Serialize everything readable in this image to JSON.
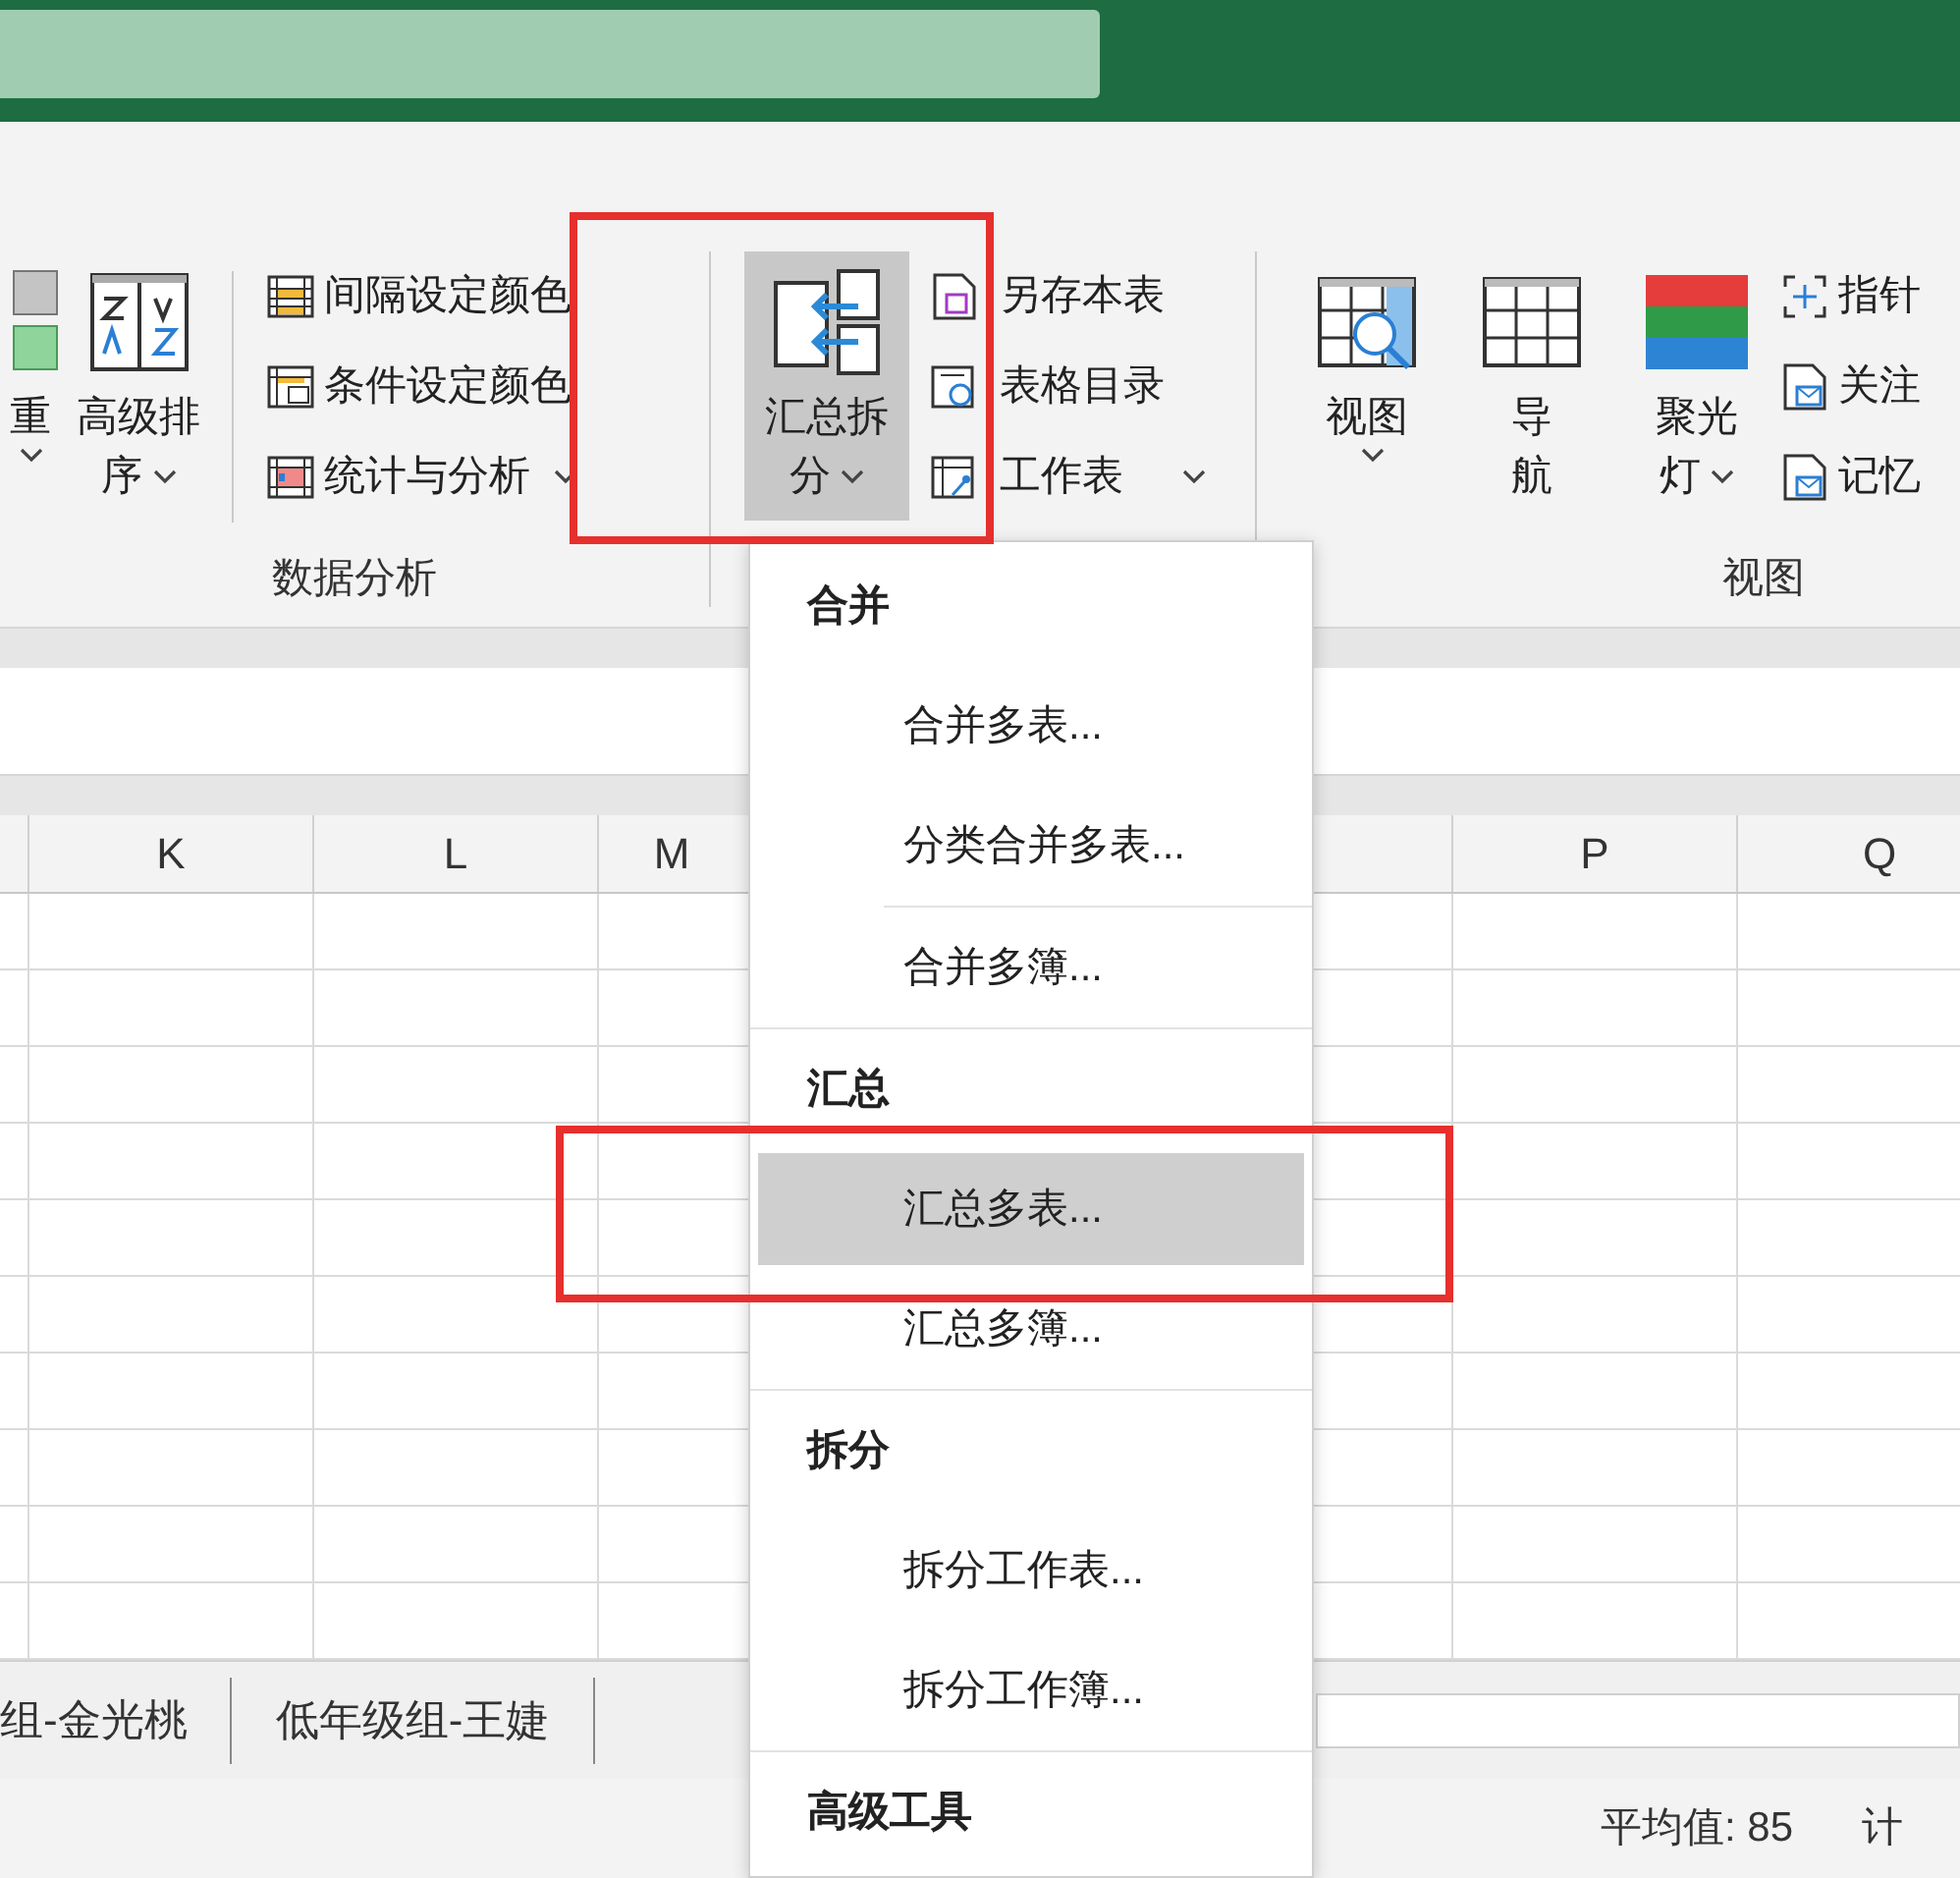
{
  "ribbon": {
    "groups": [
      {
        "label": "数据分析",
        "items": [
          {
            "kind": "large",
            "lines": [
              "重"
            ],
            "dropdown": true,
            "selected": false
          },
          {
            "kind": "large",
            "lines": [
              "高级排",
              "序"
            ],
            "dropdown": true,
            "selected": false
          },
          {
            "kind": "stack",
            "entries": [
              {
                "label": "间隔设定颜色",
                "dropdown": false
              },
              {
                "label": "条件设定颜色",
                "dropdown": false
              },
              {
                "label": "统计与分析",
                "dropdown": true
              }
            ]
          }
        ]
      },
      {
        "items": [
          {
            "kind": "large",
            "lines": [
              "汇总拆",
              "分"
            ],
            "dropdown": true,
            "selected": true
          },
          {
            "kind": "stack",
            "entries": [
              {
                "label": "另存本表",
                "dropdown": false
              },
              {
                "label": "表格目录",
                "dropdown": false
              },
              {
                "label": "工作表",
                "dropdown": true
              }
            ]
          }
        ]
      },
      {
        "label": "视图",
        "items": [
          {
            "kind": "large",
            "lines": [
              "视图"
            ],
            "dropdown": true,
            "selected": false
          },
          {
            "kind": "large",
            "lines": [
              "导",
              "航"
            ],
            "dropdown": false,
            "selected": false
          },
          {
            "kind": "large",
            "lines": [
              "聚光",
              "灯"
            ],
            "dropdown": true,
            "selected": false
          },
          {
            "kind": "stack",
            "entries": [
              {
                "label": "指针",
                "dropdown": false
              },
              {
                "label": "关注",
                "dropdown": false
              },
              {
                "label": "记忆",
                "dropdown": false
              }
            ]
          }
        ]
      }
    ]
  },
  "sheet": {
    "columns": [
      "K",
      "L",
      "M",
      null,
      null,
      "P",
      "Q"
    ]
  },
  "sheet_tabs": [
    {
      "label": "组-金光桃"
    },
    {
      "label": "低年级组-王婕"
    }
  ],
  "status_bar": {
    "items": [
      "平均值: 85",
      "计"
    ]
  },
  "dropdown_menu": {
    "sections": [
      {
        "heading": "合并",
        "items": [
          {
            "label": "合并多表...",
            "selected": false,
            "divider_above": false
          },
          {
            "label": "分类合并多表...",
            "selected": false,
            "divider_above": false
          },
          {
            "label": "合并多簿...",
            "selected": false,
            "divider_above": true
          }
        ]
      },
      {
        "heading": "汇总",
        "items": [
          {
            "label": "汇总多表...",
            "selected": true,
            "divider_above": false
          },
          {
            "label": "汇总多簿...",
            "selected": false,
            "divider_above": false
          }
        ]
      },
      {
        "heading": "拆分",
        "items": [
          {
            "label": "拆分工作表...",
            "selected": false,
            "divider_above": false
          },
          {
            "label": "拆分工作簿...",
            "selected": false,
            "divider_above": false
          }
        ]
      },
      {
        "heading": "高级工具"
      }
    ]
  },
  "annotations": [
    {
      "kind": "highlight-box",
      "color": "#e5302d"
    },
    {
      "kind": "highlight-box",
      "color": "#e5302d"
    }
  ]
}
